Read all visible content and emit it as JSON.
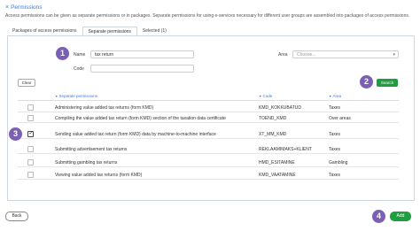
{
  "header": {
    "close_glyph": "×",
    "title": "Permissions"
  },
  "description": "Access permissions can be given as separate permissions or in packages. Separate permissions for using e-services necessary for different user groups are assembled into packages of access permissions.",
  "tabs": [
    {
      "label": "Packages of access permissions"
    },
    {
      "label": "Separate permissions"
    },
    {
      "label": "Selected (1)"
    }
  ],
  "active_tab": "Separate permissions",
  "search": {
    "name_label": "Name",
    "name_value": "tax return",
    "code_label": "Code",
    "code_value": "",
    "area_label": "Area",
    "area_placeholder": "Choose...",
    "clear_label": "Clear",
    "search_label": "Search"
  },
  "table": {
    "headers": [
      "Separate permissions",
      "Code",
      "Area"
    ],
    "rows": [
      {
        "name": "Administering value added tax returns (form KMD)",
        "code": "KMD_KOKKUBATUD",
        "area": "Taxes",
        "checked": false
      },
      {
        "name": "Compiling the value added tax return (form KMD) section of the taxation data certificate",
        "code": "TOEND_KMD",
        "area": "Over areas",
        "checked": false
      },
      {
        "name": "Sending value added tax return (form KMD) data by machine-to-machine interface",
        "code": "XT_MM_KMD",
        "area": "Taxes",
        "checked": true
      },
      {
        "name": "Submitting advertisement tax returns",
        "code": "REKLAAMIMAKS+KLIENT",
        "area": "Taxes",
        "checked": false
      },
      {
        "name": "Submitting gambling tax returns",
        "code": "HMD_ESITAMINE",
        "area": "Gambling",
        "checked": false
      },
      {
        "name": "Viewing value added tax returns (form KMD)",
        "code": "KMD_VAATAMINE",
        "area": "Taxes",
        "checked": false
      }
    ]
  },
  "footer": {
    "back_label": "Back",
    "add_label": "Add"
  },
  "badges": [
    "1",
    "2",
    "3",
    "4"
  ],
  "colors": {
    "accent": "#3a7bd5",
    "primary_button": "#1e9e3e",
    "badge": "#7b5fb4"
  }
}
